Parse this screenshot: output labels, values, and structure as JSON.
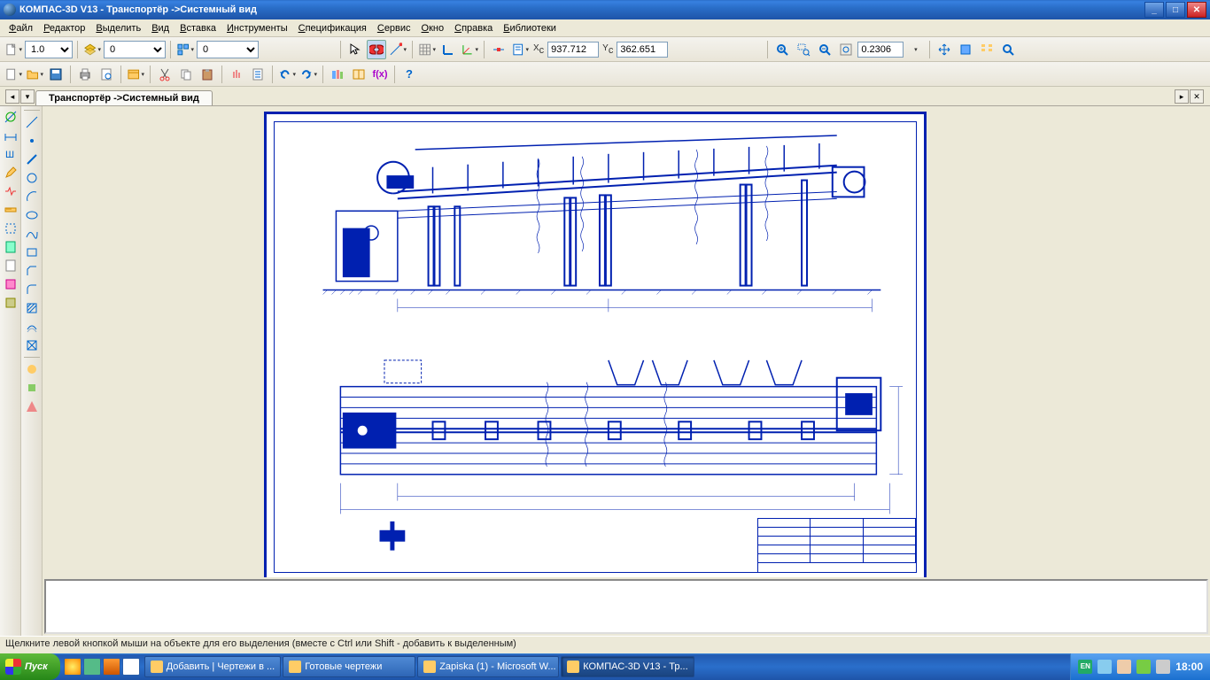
{
  "title": "КОМПАС-3D V13 - Транспортёр ->Системный вид",
  "window_controls": {
    "min": "_",
    "max": "□",
    "close": "✕"
  },
  "menubar": [
    {
      "label": "Файл",
      "u": 0
    },
    {
      "label": "Редактор",
      "u": 0
    },
    {
      "label": "Выделить",
      "u": 0
    },
    {
      "label": "Вид",
      "u": 0
    },
    {
      "label": "Вставка",
      "u": 0
    },
    {
      "label": "Инструменты",
      "u": 0
    },
    {
      "label": "Спецификация",
      "u": 0
    },
    {
      "label": "Сервис",
      "u": 0
    },
    {
      "label": "Окно",
      "u": 0
    },
    {
      "label": "Справка",
      "u": 0
    },
    {
      "label": "Библиотеки",
      "u": 0
    }
  ],
  "toolbar1": {
    "scale_value": "1.0",
    "layer_value": "0",
    "layer2_value": "0",
    "coord_x": "937.712",
    "coord_y": "362.651",
    "zoom": "0.2306"
  },
  "doc_tab": "Транспортёр ->Системный вид",
  "status": "Щелкните левой кнопкой мыши на объекте для его выделения (вместе с Ctrl или Shift - добавить к выделенным)",
  "taskbar": {
    "start": "Пуск",
    "tasks": [
      {
        "label": "Добавить | Чертежи в ...",
        "active": false
      },
      {
        "label": "Готовые чертежи",
        "active": false
      },
      {
        "label": "Zapiska (1) - Microsoft W...",
        "active": false
      },
      {
        "label": "КОМПАС-3D V13 - Тр...",
        "active": true
      }
    ],
    "lang": "EN",
    "clock": "18:00"
  }
}
